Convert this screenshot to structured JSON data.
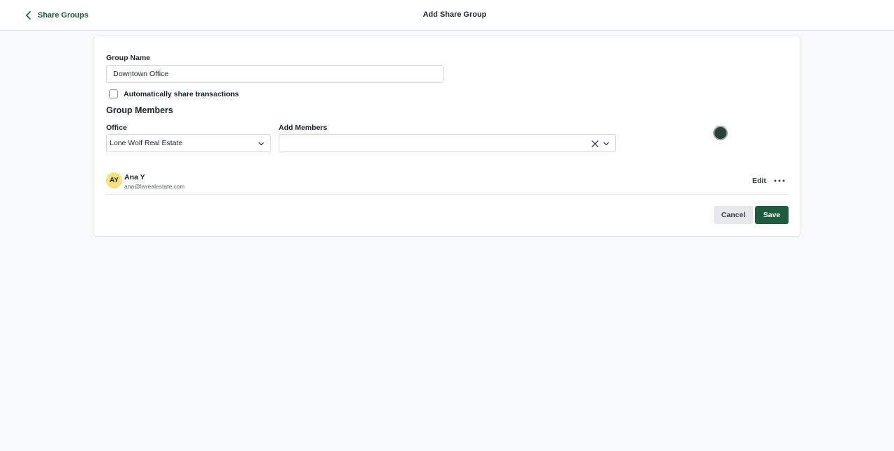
{
  "header": {
    "back_label": "Share Groups",
    "title": "Add Share Group"
  },
  "form": {
    "group_name_label": "Group Name",
    "group_name_value": "Downtown Office",
    "auto_share_label": "Automatically share transactions",
    "auto_share_checked": false,
    "members_section_title": "Group Members",
    "office_label": "Office",
    "office_value": "Lone Wolf Real Estate",
    "add_members_label": "Add Members",
    "add_members_value": ""
  },
  "members": [
    {
      "initials": "AY",
      "name": "Ana Y",
      "email": "ana@lwrealestate.com",
      "edit_label": "Edit",
      "avatar_color": "#f6e27a"
    }
  ],
  "actions": {
    "cancel_label": "Cancel",
    "save_label": "Save"
  },
  "colors": {
    "accent": "#1f5c3f",
    "background": "#f8f9fa"
  },
  "icons": [
    "chevron-left-icon",
    "chevron-down-icon",
    "clear-icon",
    "more-horizontal-icon"
  ]
}
